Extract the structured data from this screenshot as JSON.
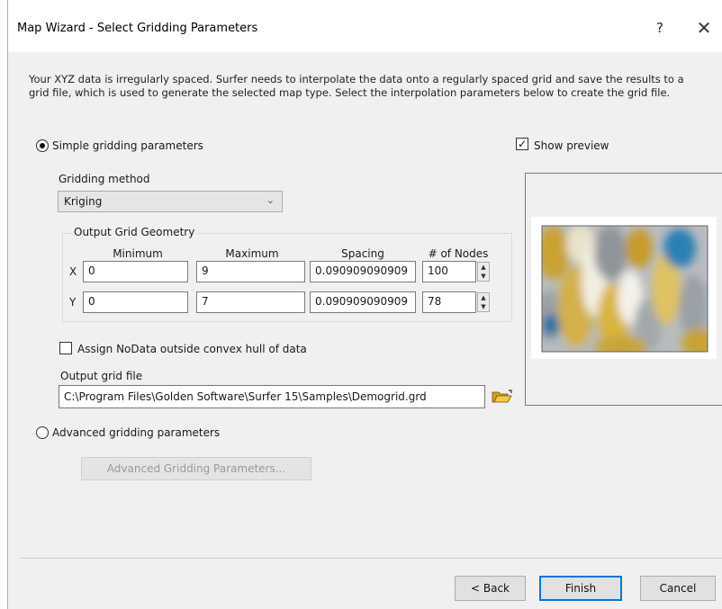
{
  "window": {
    "title": "Map Wizard - Select Gridding Parameters",
    "help_label": "?",
    "close_label": "✕"
  },
  "intro_text": "Your XYZ data is irregularly spaced. Surfer needs to interpolate the data onto a regularly spaced grid and save the results to a grid file, which is used to generate the selected map type. Select the interpolation parameters below to create the grid file.",
  "simple": {
    "radio_label": "Simple gridding parameters",
    "selected": true,
    "method_label": "Gridding method",
    "method_value": "Kriging",
    "geometry": {
      "title": "Output Grid Geometry",
      "headers": {
        "min": "Minimum",
        "max": "Maximum",
        "spacing": "Spacing",
        "nodes": "# of Nodes"
      },
      "x": {
        "label": "X",
        "min": "0",
        "max": "9",
        "spacing": "0.090909090909",
        "nodes": "100"
      },
      "y": {
        "label": "Y",
        "min": "0",
        "max": "7",
        "spacing": "0.090909090909",
        "nodes": "78"
      }
    },
    "nodata_label": "Assign NoData outside convex hull of data",
    "nodata_checked": false,
    "output_label": "Output grid file",
    "output_path": "C:\\Program Files\\Golden Software\\Surfer 15\\Samples\\Demogrid.grd"
  },
  "advanced": {
    "radio_label": "Advanced gridding parameters",
    "selected": false,
    "button_label": "Advanced Gridding Parameters..."
  },
  "preview": {
    "checkbox_label": "Show preview",
    "checked": true
  },
  "footer": {
    "back_label": "< Back",
    "finish_label": "Finish",
    "cancel_label": "Cancel"
  },
  "colors": {
    "accent": "#0078d7",
    "preview_blue": "#1f6fa3",
    "preview_yellow": "#c9a232",
    "preview_grey": "#9aa0a6"
  },
  "icons": {
    "help": "question-mark-icon",
    "close": "close-icon",
    "combo": "chevron-down-icon",
    "folder": "open-folder-icon",
    "spin_up": "spin-up-icon",
    "spin_down": "spin-down-icon"
  }
}
